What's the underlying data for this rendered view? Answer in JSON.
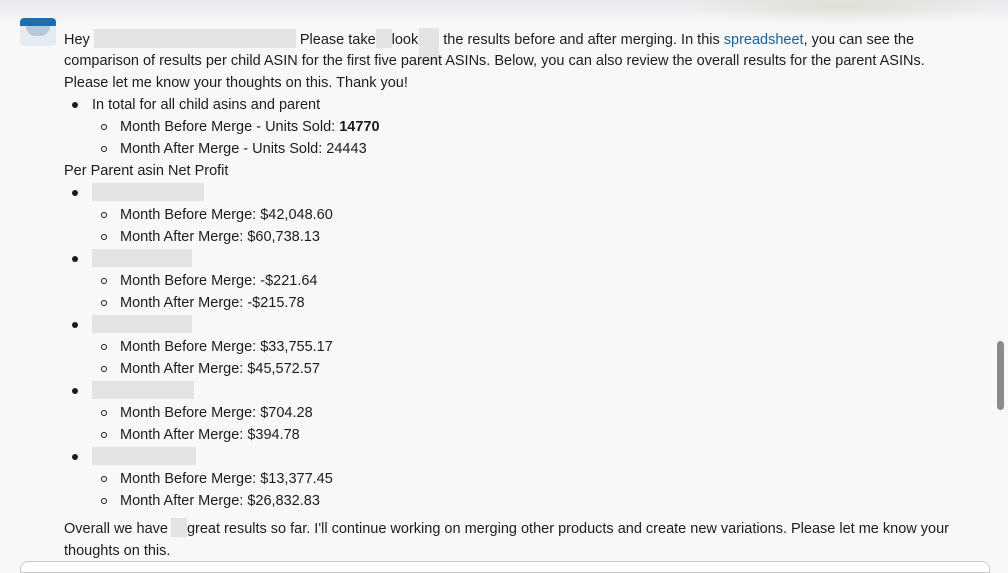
{
  "message": {
    "greeting": "Hey",
    "intro_part1": "Please take",
    "intro_part2": "look",
    "intro_part3": "the results before and after merging. In this",
    "spreadsheet_link": "spreadsheet",
    "intro_part4": ", you can see the",
    "intro_line2": "comparison of results per child ASIN for the first five parent ASINs. Below, you can also review the overall results for the parent ASINs.",
    "intro_line3": "Please let me know your thoughts on this. Thank you!",
    "total_heading": "In total for all child asins and parent",
    "units_before_label": "Month Before Merge - Units Sold:",
    "units_before_value": "14770",
    "units_after": "Month After Merge - Units Sold: 24443",
    "per_parent_heading": "Per Parent asin Net Profit",
    "parents": [
      {
        "before": "Month Before Merge: $42,048.60",
        "after": "Month After Merge: $60,738.13"
      },
      {
        "before": "Month Before Merge: -$221.64",
        "after": "Month After Merge: -$215.78"
      },
      {
        "before": "Month Before Merge: $33,755.17",
        "after": "Month After Merge: $45,572.57"
      },
      {
        "before": "Month Before Merge: $704.28",
        "after": "Month After Merge: $394.78"
      },
      {
        "before": "Month Before Merge: $13,377.45",
        "after": "Month After Merge: $26,832.83"
      }
    ],
    "overall_part1": "Overall we have",
    "overall_part2": "great results so far. I'll continue working on merging other products and create new variations. Please let me know your",
    "overall_line2": "thoughts on this."
  }
}
